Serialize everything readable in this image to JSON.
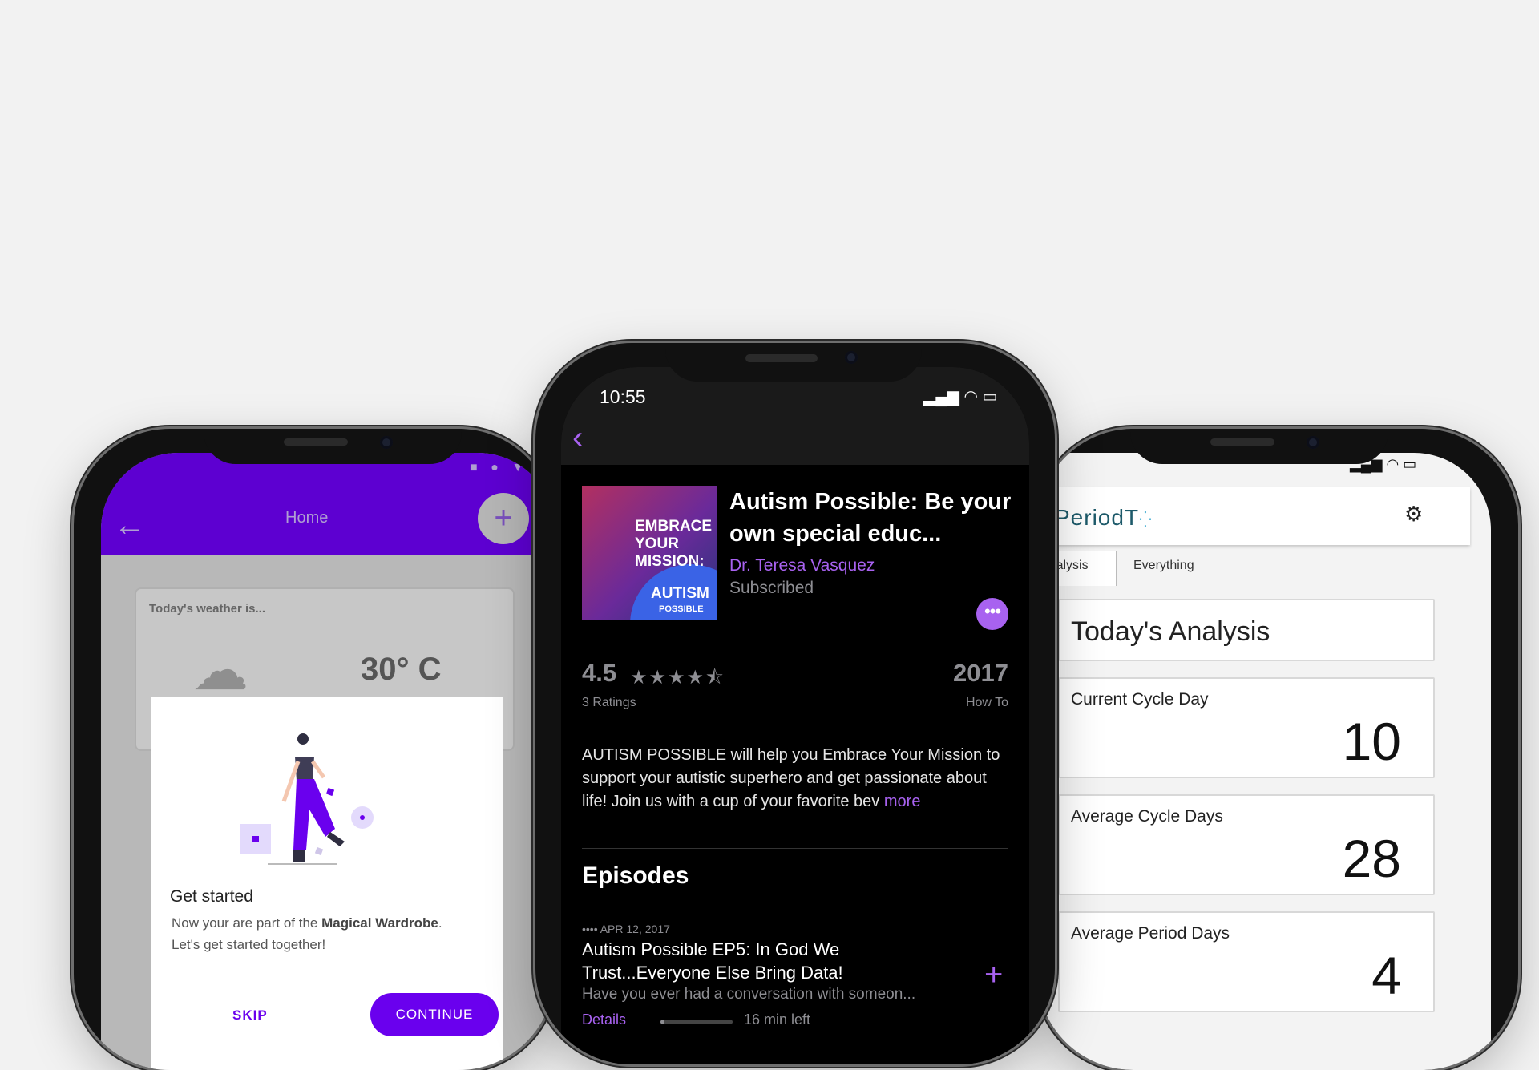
{
  "left_app": {
    "status_icons": "■ ● ▼",
    "appbar": {
      "back_icon": "←",
      "title": "Home",
      "fab_icon": "+"
    },
    "weather": {
      "label": "Today's weather is...",
      "temperature": "30° C"
    },
    "dialog": {
      "title": "Get started",
      "desc_part1": "Now your are part of the ",
      "desc_brand": "Magical Wardrobe",
      "desc_part2": ".",
      "desc_line2": "Let's get started together!",
      "skip_label": "SKIP",
      "continue_label": "CONTINUE"
    },
    "colors": {
      "primary": "#6a00ee"
    }
  },
  "center_app": {
    "status_time": "10:55",
    "back_icon": "‹",
    "artwork": {
      "line1": "EMBRACE",
      "line2": "YOUR",
      "line3": "MISSION:",
      "brand": "AUTISM",
      "brand_sub": "POSSIBLE"
    },
    "podcast": {
      "title": "Autism Possible: Be your own special educ...",
      "author": "Dr. Teresa Vasquez",
      "status": "Subscribed"
    },
    "rating": {
      "value": "4.5",
      "stars": "★★★★⯪",
      "count_label": "3 Ratings"
    },
    "year": "2017",
    "genre": "How To",
    "description": "AUTISM POSSIBLE will help you Embrace Your Mission to support your autistic superhero and get passionate about life! Join us with a cup of your favorite bev",
    "description_more": "more",
    "episodes_heading": "Episodes",
    "episode": {
      "date": "•••• APR 12, 2017",
      "title": "Autism Possible EP5: In God We Trust...Everyone Else Bring Data!",
      "desc": "Have you ever had a conversation with someon...",
      "details_label": "Details",
      "time_left": "16 min left",
      "progress_fraction": 0.05
    },
    "colors": {
      "accent": "#a862f0"
    }
  },
  "right_app": {
    "logo": "PeriodT",
    "tabs": [
      "Analysis",
      "Everything"
    ],
    "heading": "Today's Analysis",
    "cards": [
      {
        "title": "Current Cycle Day",
        "value": "10"
      },
      {
        "title": "Average Cycle Days",
        "value": "28"
      },
      {
        "title": "Average Period Days",
        "value": "4"
      }
    ]
  }
}
